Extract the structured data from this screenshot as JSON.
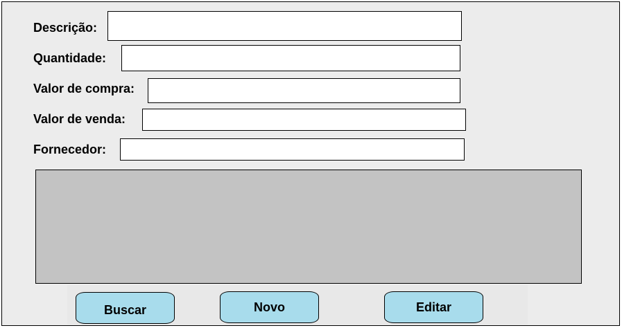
{
  "form": {
    "fields": [
      {
        "label": "Descrição:",
        "value": ""
      },
      {
        "label": "Quantidade:",
        "value": ""
      },
      {
        "label": "Valor de compra:",
        "value": ""
      },
      {
        "label": "Valor de venda:",
        "value": ""
      },
      {
        "label": "Fornecedor:",
        "value": ""
      }
    ]
  },
  "buttons": {
    "search_label": "Buscar",
    "new_label": "Novo",
    "edit_label": "Editar"
  },
  "colors": {
    "window_background": "#ececec",
    "grid_background": "#c3c3c3",
    "button_background": "#a8dcec"
  }
}
